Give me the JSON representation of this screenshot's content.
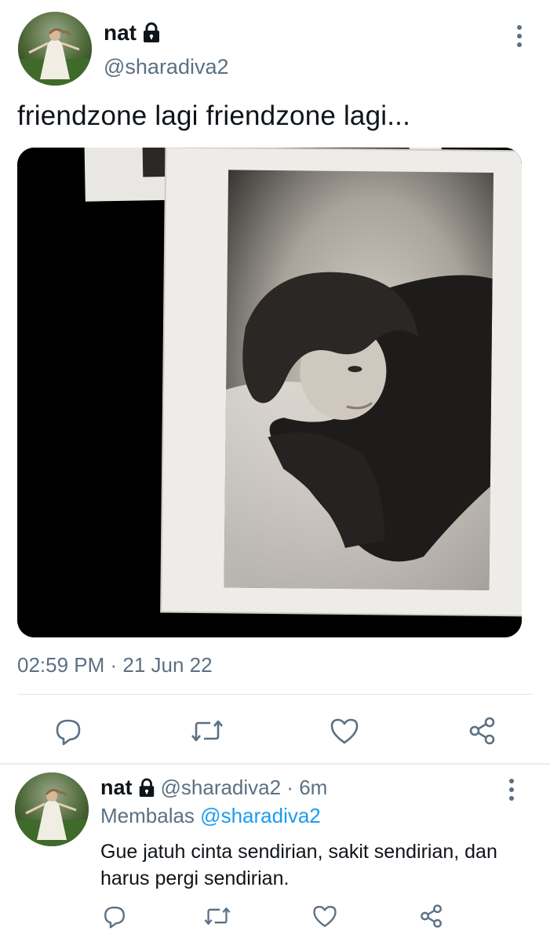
{
  "main_tweet": {
    "display_name": "nat",
    "handle": "@sharadiva2",
    "text": "friendzone lagi friendzone lagi...",
    "timestamp": "02:59 PM · 21 Jun 22",
    "protected_icon": "lock-icon",
    "actions": [
      "reply-icon",
      "retweet-icon",
      "like-icon",
      "share-icon"
    ]
  },
  "reply_tweet": {
    "display_name": "nat",
    "handle": "@sharadiva2",
    "separator": " · ",
    "time_ago": "6m",
    "replying_prefix": "Membalas",
    "replying_to": "@sharadiva2",
    "text": "Gue jatuh cinta sendirian, sakit sendirian, dan harus pergi sendirian.",
    "actions": [
      "reply-icon",
      "retweet-icon",
      "like-icon",
      "share-icon"
    ]
  },
  "colors": {
    "text_primary": "#0f1419",
    "text_secondary": "#5b7083",
    "link": "#1d9bf0",
    "divider": "#e3e7ea"
  }
}
